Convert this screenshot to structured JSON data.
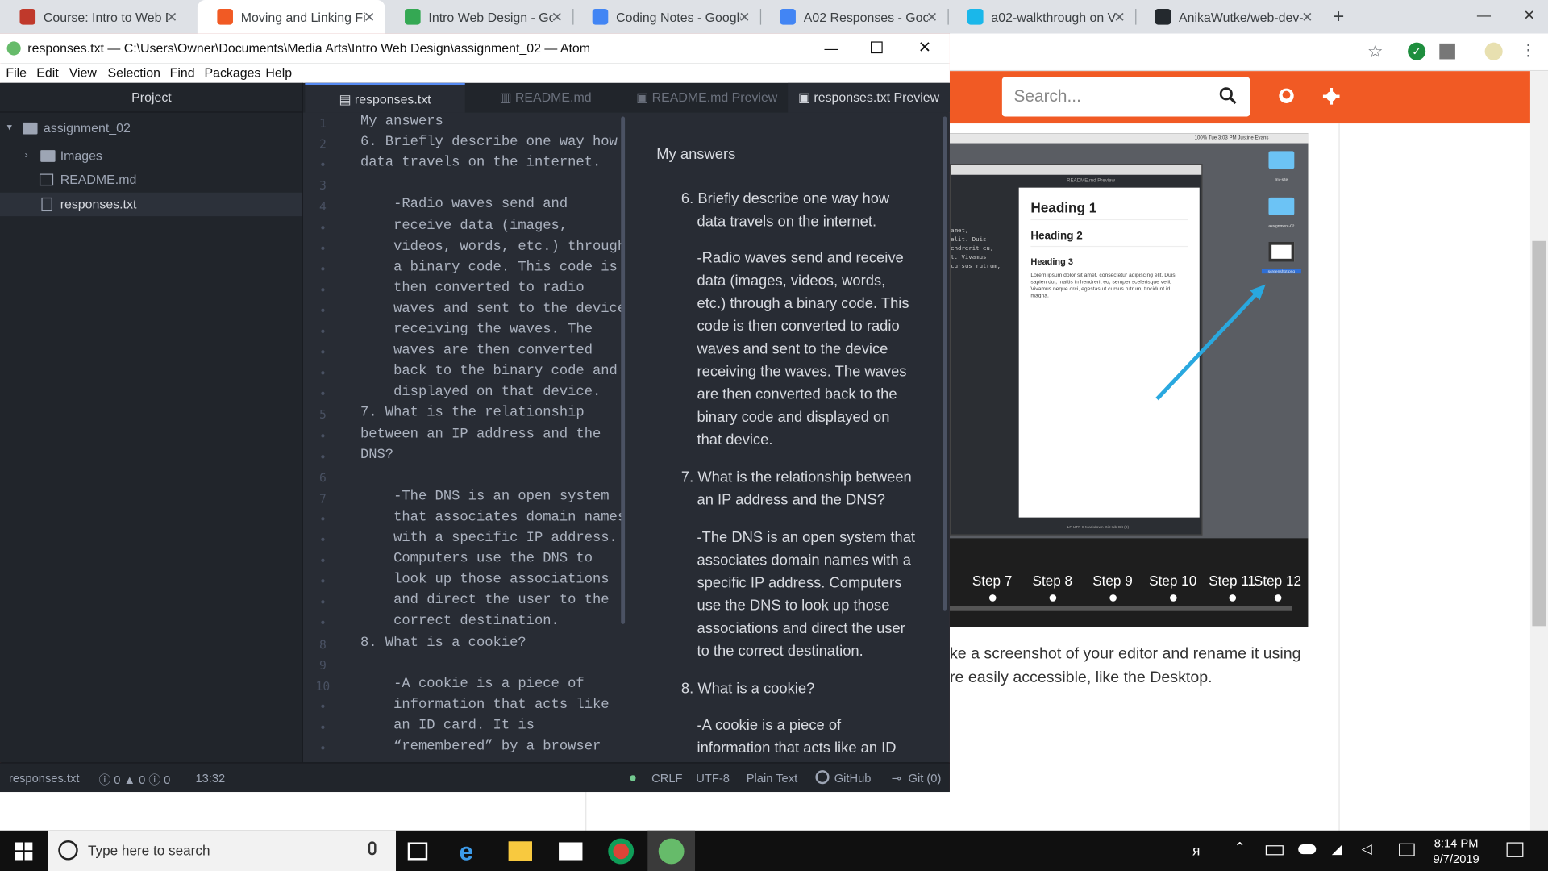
{
  "browser": {
    "tabs": [
      {
        "title": "Course: Intro to Web D",
        "icon_color": "#c0392b"
      },
      {
        "title": "Moving and Linking Fil",
        "icon_color": "#f15a24"
      },
      {
        "title": "Intro Web Design - Go",
        "icon_color": "#34a853"
      },
      {
        "title": "Coding Notes - Google",
        "icon_color": "#4285f4"
      },
      {
        "title": "A02 Responses - Goog",
        "icon_color": "#4285f4"
      },
      {
        "title": "a02-walkthrough on Vi",
        "icon_color": "#1ab7ea"
      },
      {
        "title": "AnikaWutke/web-dev-",
        "icon_color": "#24292e"
      }
    ],
    "new_tab": "+",
    "search_placeholder": "Search..."
  },
  "video": {
    "steps": [
      "Step 7",
      "Step 8",
      "Step 9",
      "Step 10",
      "Step 11",
      "Step 12"
    ],
    "md_heading1": "Heading 1",
    "md_heading2": "Heading 2",
    "md_heading3": "Heading 3",
    "md_body": "Lorem ipsum dolor sit amet, consectetur adipiscing elit. Duis sapien dui, mattis in hendrerit eu, semper scelerisque velit. Vivamus neque orci, egestas ut cursus rutrum, tincidunt id magna.",
    "md_tab": "README.md Preview",
    "desk_label1": "my-site",
    "desk_label2": "assignment-02",
    "desk_label3": "screenshot.png",
    "menubar_text": "100%   Tue 3:03 PM   Justine Evans",
    "status_text": "LF   UTF-8   Markdown   GitHub   Git (0)",
    "left_code": "amet,\nelit. Duis\nendrerit eu,\nt. Vivamus\ncursus rutrum,"
  },
  "web_text": {
    "line1": "ke a screenshot of your editor and rename it using",
    "line2": "re easily accessible, like the Desktop."
  },
  "atom": {
    "title": "responses.txt — C:\\Users\\Owner\\Documents\\Media Arts\\Intro Web Design\\assignment_02 — Atom",
    "menu": [
      "File",
      "Edit",
      "View",
      "Selection",
      "Find",
      "Packages",
      "Help"
    ],
    "project_label": "Project",
    "tree": {
      "root": "assignment_02",
      "images": "Images",
      "readme": "README.md",
      "responses": "responses.txt"
    },
    "tabs": [
      "responses.txt",
      "README.md",
      "README.md Preview",
      "responses.txt Preview"
    ],
    "gutter": [
      "1",
      "2",
      "•",
      "3",
      "4",
      "•",
      "•",
      "•",
      "•",
      "•",
      "•",
      "•",
      "•",
      "•",
      "5",
      "•",
      "•",
      "6",
      "7",
      "•",
      "•",
      "•",
      "•",
      "•",
      "•",
      "8",
      "9",
      "10",
      "•",
      "•",
      "•"
    ],
    "code_lines": [
      "My answers",
      "6. Briefly describe one way how",
      "data travels on the internet.",
      "",
      "    -Radio waves send and",
      "    receive data (images,",
      "    videos, words, etc.) through",
      "    a binary code. This code is",
      "    then converted to radio",
      "    waves and sent to the device",
      "    receiving the waves. The",
      "    waves are then converted",
      "    back to the binary code and",
      "    displayed on that device.",
      "7. What is the relationship",
      "between an IP address and the",
      "DNS?",
      "",
      "    -The DNS is an open system",
      "    that associates domain names",
      "    with a specific IP address.",
      "    Computers use the DNS to",
      "    look up those associations",
      "    and direct the user to the",
      "    correct destination.",
      "8. What is a cookie?",
      "",
      "    -A cookie is a piece of",
      "    information that acts like",
      "    an ID card. It is",
      "    “remembered” by a browser"
    ],
    "preview": {
      "heading": "My answers",
      "q6": "6. Briefly describe one way how data travels on the internet.",
      "a6": "-Radio waves send and receive data (images, videos, words, etc.) through a binary code. This code is then converted to radio waves and sent to the device receiving the waves. The waves are then converted back to the binary code and displayed on that device.",
      "q7": "7. What is the relationship between an IP address and the DNS?",
      "a7": "-The DNS is an open system that associates domain names with a specific IP address. Computers use the DNS to look up those associations and direct the user to the correct destination.",
      "q8": "8. What is a cookie?",
      "a8": "-A cookie is a piece of information that acts like an ID"
    },
    "status": {
      "file": "responses.txt",
      "errors": "ⓘ 0 ▲ 0 ⓘ 0",
      "cursor": "13:32",
      "line_ending": "CRLF",
      "encoding": "UTF-8",
      "grammar": "Plain Text",
      "github": "GitHub",
      "git": "Git (0)"
    }
  },
  "taskbar": {
    "search_placeholder": "Type here to search",
    "time": "8:14 PM",
    "date": "9/7/2019"
  }
}
